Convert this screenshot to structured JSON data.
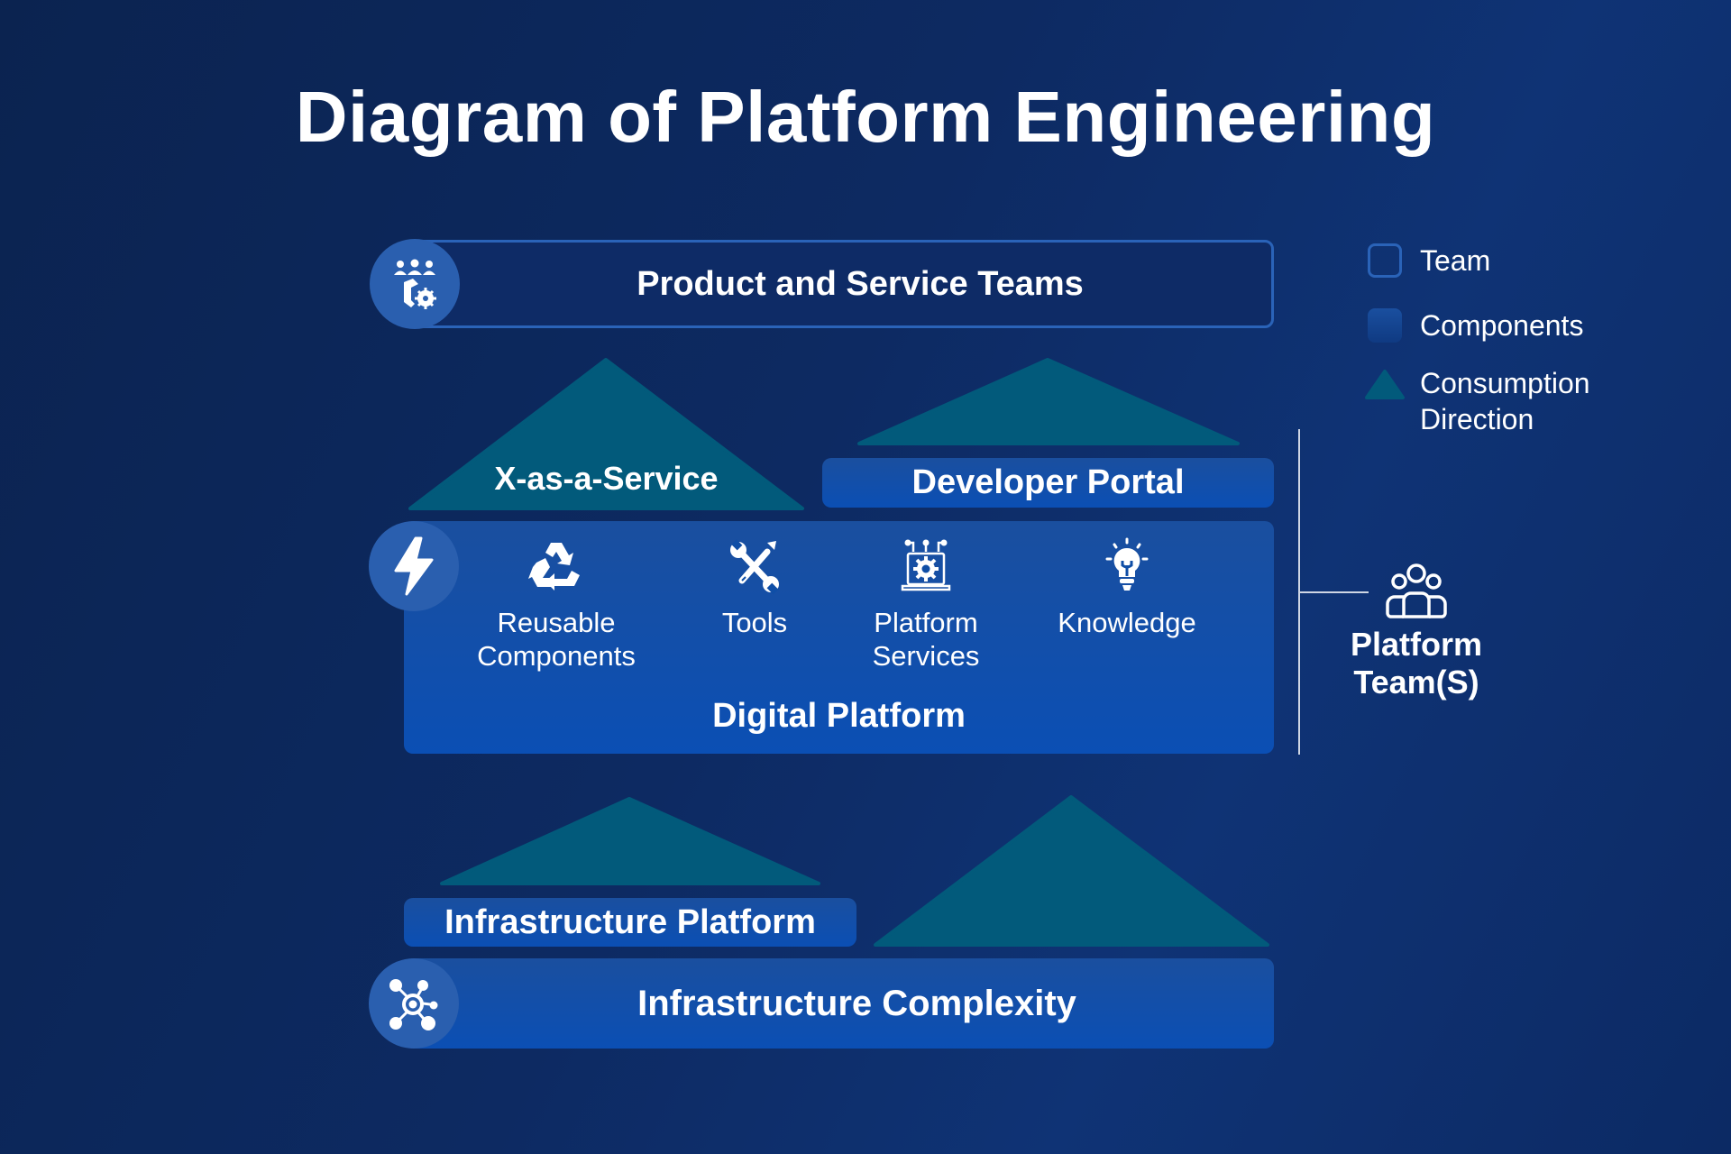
{
  "title": "Diagram of Platform Engineering",
  "colors": {
    "background": "#0d2a62",
    "team_border": "#2a63b8",
    "component_fill": "#0b4fb4",
    "triangle_fill": "#025a7b",
    "circle_fill": "#2a5faf",
    "text": "#ffffff"
  },
  "layers": {
    "product_teams": {
      "label": "Product and Service Teams",
      "icon": "team-gear-icon"
    },
    "x_as_a_service": {
      "label": "X-as-a-Service"
    },
    "developer_portal": {
      "label": "Developer Portal"
    },
    "digital_platform": {
      "label": "Digital Platform",
      "icon": "lightning-icon",
      "items": [
        {
          "label_line1": "Reusable",
          "label_line2": "Components",
          "icon": "recycle-icon"
        },
        {
          "label_line1": "Tools",
          "label_line2": "",
          "icon": "tools-icon"
        },
        {
          "label_line1": "Platform",
          "label_line2": "Services",
          "icon": "laptop-gear-icon"
        },
        {
          "label_line1": "Knowledge",
          "label_line2": "",
          "icon": "lightbulb-icon"
        }
      ]
    },
    "infrastructure_platform": {
      "label": "Infrastructure Platform"
    },
    "infrastructure_complexity": {
      "label": "Infrastructure Complexity",
      "icon": "network-hub-icon"
    }
  },
  "platform_team": {
    "label_line1": "Platform",
    "label_line2": "Team(S)",
    "icon": "people-group-icon"
  },
  "legend": {
    "items": [
      {
        "label": "Team",
        "symbol": "outlined-square"
      },
      {
        "label": "Components",
        "symbol": "filled-square"
      },
      {
        "label_line1": "Consumption",
        "label_line2": "Direction",
        "symbol": "triangle"
      }
    ]
  }
}
